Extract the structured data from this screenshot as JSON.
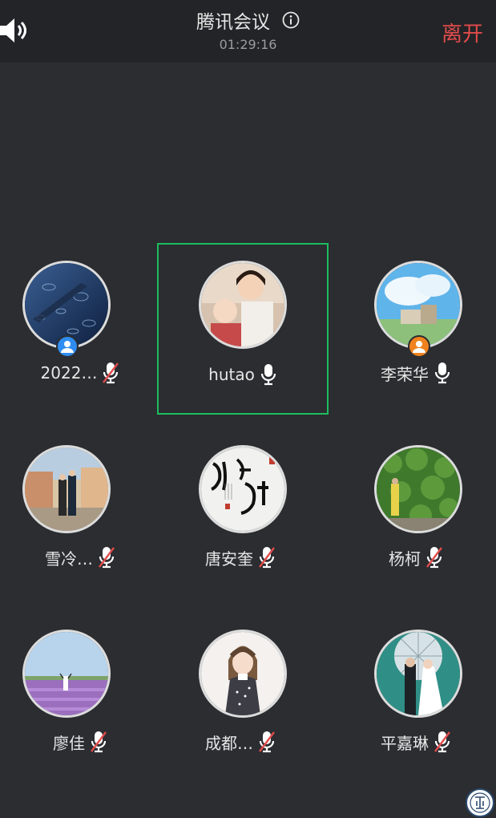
{
  "header": {
    "title": "腾讯会议",
    "timer": "01:29:16",
    "leave_label": "离开"
  },
  "icons": {
    "speaker": "speaker-icon",
    "info": "info-icon",
    "mic_on": "mic-icon",
    "mic_muted": "mic-muted-icon",
    "person_badge": "person-badge-icon"
  },
  "colors": {
    "accent_red": "#e14b4b",
    "active_border": "#1dbd5e",
    "badge_blue": "#2f8cf0",
    "badge_orange": "#f0821e"
  },
  "participants": [
    {
      "name": "2022…",
      "mic": "muted",
      "badge": "blue"
    },
    {
      "name": "hutao",
      "mic": "on",
      "badge": "none",
      "active": true
    },
    {
      "name": "李荣华",
      "mic": "on",
      "badge": "orange"
    },
    {
      "name": "雪冷…",
      "mic": "muted",
      "badge": "none"
    },
    {
      "name": "唐安奎",
      "mic": "muted",
      "badge": "none"
    },
    {
      "name": "杨柯",
      "mic": "muted",
      "badge": "none"
    },
    {
      "name": "廖佳",
      "mic": "muted",
      "badge": "none"
    },
    {
      "name": "成都…",
      "mic": "muted",
      "badge": "none"
    },
    {
      "name": "平嘉琳",
      "mic": "muted",
      "badge": "none"
    }
  ]
}
